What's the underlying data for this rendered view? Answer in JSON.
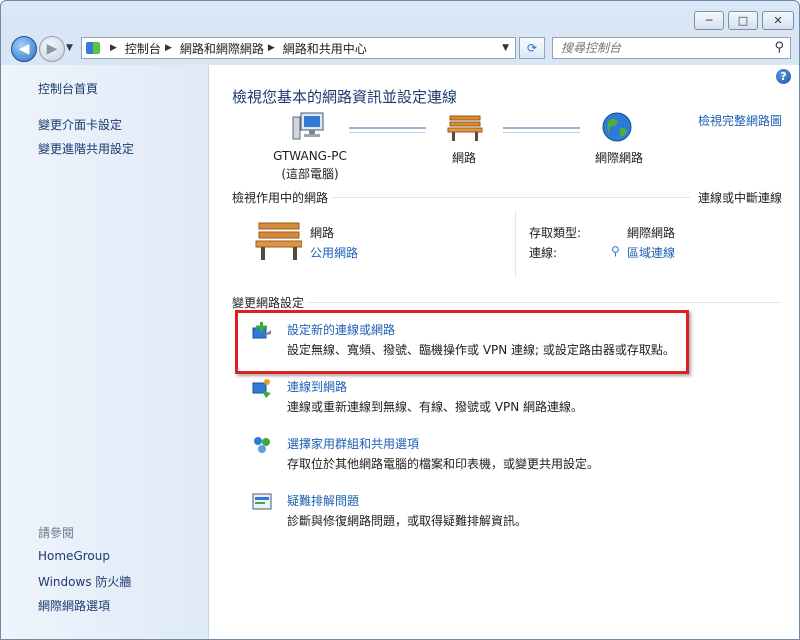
{
  "window": {
    "controls": {
      "minimize": "─",
      "maximize": "□",
      "close": "✕"
    }
  },
  "nav": {
    "back_icon": "back-arrow-icon",
    "forward_icon": "forward-arrow-icon",
    "breadcrumbs": [
      "控制台",
      "網路和網際網路",
      "網路和共用中心"
    ],
    "search_placeholder": "搜尋控制台"
  },
  "sidebar": {
    "home": "控制台首頁",
    "links": [
      "變更介面卡設定",
      "變更進階共用設定"
    ],
    "see_also_heading": "請參閱",
    "see_also": [
      "HomeGroup",
      "Windows 防火牆",
      "網際網路選項"
    ]
  },
  "main": {
    "title": "檢視您基本的網路資訊並設定連線",
    "see_full_map": "檢視完整網路圖",
    "map": {
      "computer_name": "GTWANG-PC",
      "computer_sub": "(這部電腦)",
      "network": "網路",
      "internet": "網際網路"
    },
    "active_section": {
      "heading": "檢視作用中的網路",
      "connect_link": "連線或中斷連線",
      "network_name": "網路",
      "network_type": "公用網路",
      "access_type_label": "存取類型:",
      "access_type_value": "網際網路",
      "connections_label": "連線:",
      "connections_value": "區域連線"
    },
    "change_section": {
      "heading": "變更網路設定",
      "tasks": [
        {
          "title": "設定新的連線或網路",
          "desc": "設定無線、寬頻、撥號、臨機操作或 VPN 連線; 或設定路由器或存取點。"
        },
        {
          "title": "連線到網路",
          "desc": "連線或重新連線到無線、有線、撥號或 VPN 網路連線。"
        },
        {
          "title": "選擇家用群組和共用選項",
          "desc": "存取位於其他網路電腦的檔案和印表機，或變更共用設定。"
        },
        {
          "title": "疑難排解問題",
          "desc": "診斷與修復網路問題，或取得疑難排解資訊。"
        }
      ]
    }
  },
  "colors": {
    "link": "#1e5fb3",
    "highlight_border": "#e02020"
  }
}
